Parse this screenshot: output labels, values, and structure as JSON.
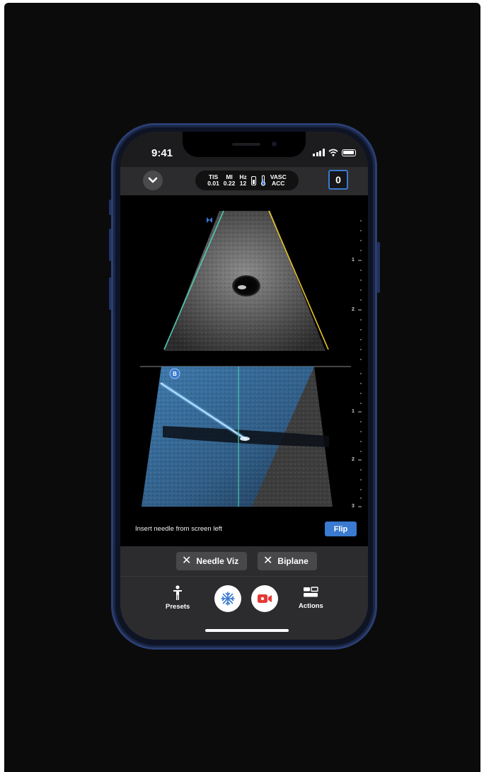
{
  "status_bar": {
    "time": "9:41"
  },
  "header": {
    "params": [
      {
        "label": "TIS",
        "value": "0.01"
      },
      {
        "label": "MI",
        "value": "0.22"
      },
      {
        "label": "Hz",
        "value": "12"
      }
    ],
    "preset_line1": "VASC",
    "preset_line2": "ACC",
    "counter": "0"
  },
  "imaging": {
    "top_plane_marker": "butterfly-icon",
    "bottom_plane_badge": "B",
    "depth_labels_top": [
      "1",
      "2"
    ],
    "depth_labels_bottom": [
      "1",
      "2",
      "3"
    ],
    "colors": {
      "guide_left": "#4ec9b0",
      "guide_right": "#e6c229",
      "needle_overlay": "#5aaeea"
    }
  },
  "hint": {
    "text": "Insert needle from screen left",
    "flip_label": "Flip"
  },
  "chips": [
    {
      "label": "Needle Viz",
      "icon": "close-icon"
    },
    {
      "label": "Biplane",
      "icon": "close-icon"
    }
  ],
  "toolbar": {
    "presets_label": "Presets",
    "actions_label": "Actions",
    "freeze_icon": "snowflake-icon",
    "record_icon": "video-camera-icon"
  },
  "colors": {
    "accent": "#3a7ad0",
    "record": "#e53935",
    "frame": "#2b3e72"
  }
}
